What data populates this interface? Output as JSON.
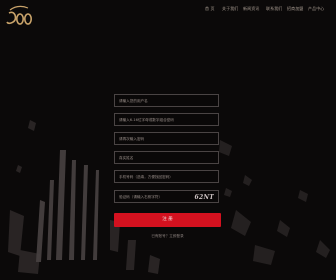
{
  "brand": {
    "logo_text": "50"
  },
  "nav": {
    "items": [
      "首 页",
      "关于我们",
      "新闻资讯",
      "联系我们",
      "招商加盟",
      "产品中心"
    ]
  },
  "form": {
    "fields": [
      {
        "placeholder": "请输入您的用户名"
      },
      {
        "placeholder": "请输入6-16位字母或数字组合密码"
      },
      {
        "placeholder": "请再次输入密码"
      },
      {
        "placeholder": "真实姓名"
      },
      {
        "placeholder": "手机号码（选填，方便找回密码）"
      },
      {
        "placeholder": "验证码（请输入右侧字符）"
      }
    ],
    "captcha": "62NT",
    "submit_label": "注 册",
    "footer_link": "已有账号？立即登录"
  },
  "colors": {
    "accent": "#d4111f",
    "background": "#0b0909"
  }
}
